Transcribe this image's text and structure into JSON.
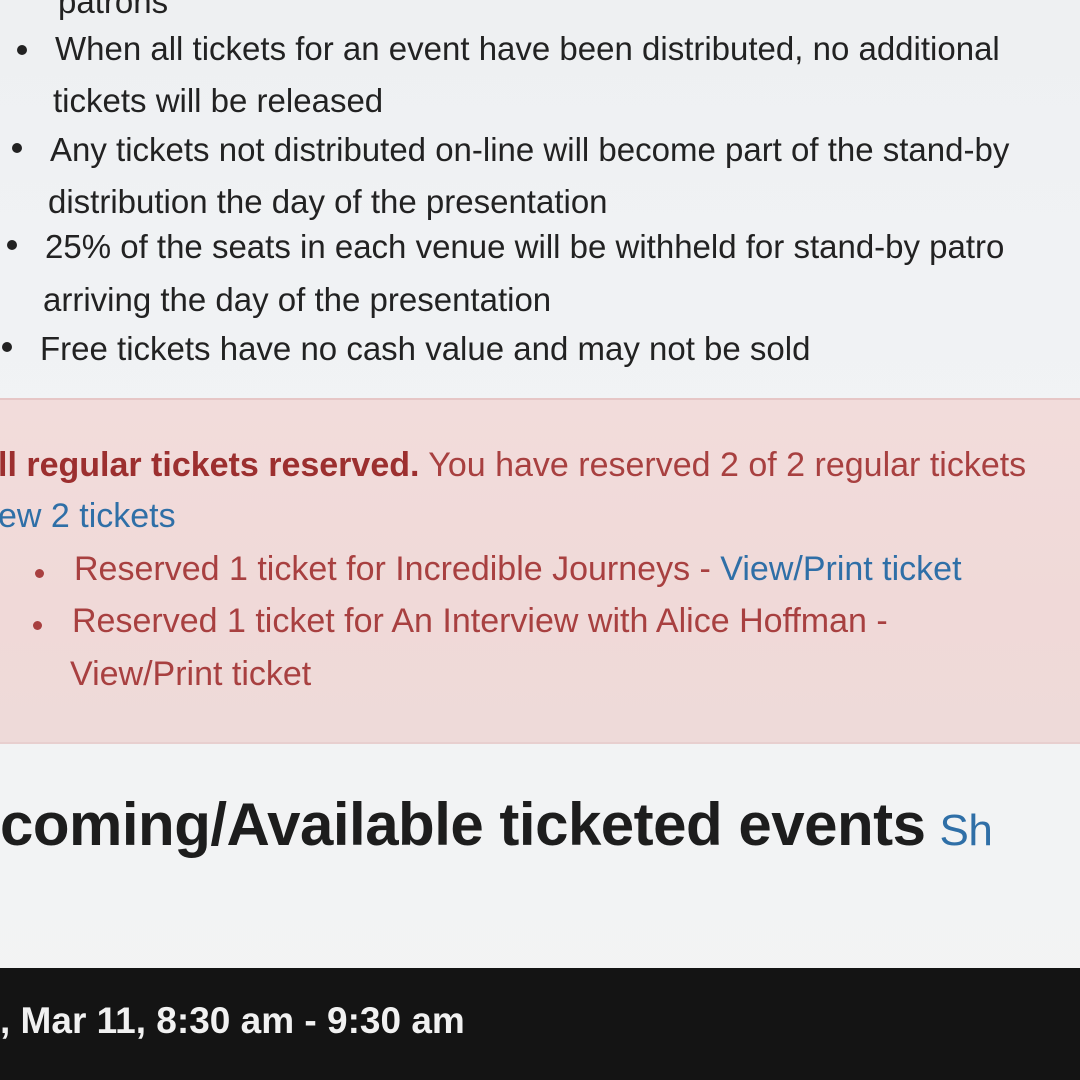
{
  "rules": {
    "item0_tail": "patrons",
    "item1_line1": "When all tickets for an event have been distributed, no additional",
    "item1_line2": "tickets will be released",
    "item2_line1": "Any tickets not distributed on-line will become part of the stand-by",
    "item2_line2": "distribution the day of the presentation",
    "item3_line1": "25% of the seats in each venue will be withheld for stand-by patro",
    "item3_line2": "arriving the day of the presentation",
    "item4_line1": "Free tickets have no cash value and may not be sold"
  },
  "alert": {
    "strong": "ll regular tickets reserved.",
    "text": "You have reserved 2 of 2 regular tickets",
    "view_link": "ew 2 tickets",
    "items": [
      {
        "label": "Reserved 1 ticket for Incredible Journeys -",
        "link": "View/Print ticket"
      },
      {
        "label": "Reserved 1 ticket for An Interview with Alice Hoffman -",
        "link": "View/Print ticket"
      }
    ],
    "colors": {
      "background": "#f2dcdb",
      "text": "#a84040",
      "link": "#2f6fa7"
    }
  },
  "section": {
    "title": "coming/Available ticketed events",
    "link": "Sh"
  },
  "event": {
    "time": ", Mar 11, 8:30 am - 9:30 am"
  }
}
